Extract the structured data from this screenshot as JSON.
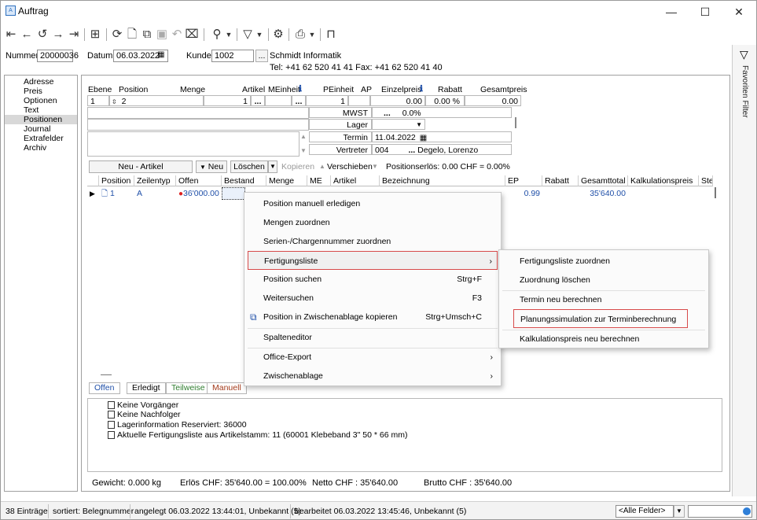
{
  "window": {
    "title": "Auftrag",
    "minimize": "—",
    "maximize": "☐",
    "close": "✕"
  },
  "header": {
    "nummer_label": "Nummer",
    "nummer_value": "20000036",
    "datum_label": "Datum",
    "datum_value": "06.03.2022",
    "kunde_label": "Kunde",
    "kunde_value": "1002",
    "kunde_name": "Schmidt Informatik",
    "kunde_contact": "Tel: +41 62 520 41 41   Fax: +41 62 520 41 40",
    "ellipsis": "..."
  },
  "nav": {
    "items": [
      "Adresse",
      "Preis",
      "Optionen",
      "Text",
      "Positionen",
      "Journal",
      "Extrafelder",
      "Archiv"
    ],
    "selected": "Positionen"
  },
  "right_panel": {
    "label": "Favoriten Filter"
  },
  "position_form": {
    "headers": {
      "ebene": "Ebene",
      "position": "Position",
      "menge": "Menge",
      "artikel": "Artikel",
      "meinheit": "MEinheit",
      "peinheit": "PEinheit",
      "ap": "AP",
      "einzelpreis": "Einzelpreis",
      "rabatt": "Rabatt",
      "gesamtpreis": "Gesamtpreis"
    },
    "values": {
      "ebene": "1",
      "position": "2",
      "menge": "1",
      "peinheit": "1",
      "einzelpreis": "0.00",
      "rabatt": "0.00 %",
      "gesamtpreis": "0.00"
    },
    "mwst_label": "MWST",
    "mwst_value": "0.0%",
    "lager_label": "Lager",
    "termin_label": "Termin",
    "termin_value": "11.04.2022",
    "vertreter_label": "Vertreter",
    "vertreter_value": "004",
    "vertreter_name": "Degelo, Lorenzo"
  },
  "grid_toolbar": {
    "neu_artikel": "Neu - Artikel",
    "neu": "Neu",
    "loeschen": "Löschen",
    "kopieren": "Kopieren",
    "verschieben": "Verschieben",
    "positionserloes": "Positionserlös:  0.00 CHF = 0.00%"
  },
  "grid": {
    "columns": [
      "Position",
      "Zeilentyp",
      "Offen",
      "Bestand",
      "Menge",
      "ME",
      "Artikel",
      "Bezeichnung",
      "EP",
      "Rabatt",
      "Gesamttotal",
      "Kalkulationspreis",
      "Ste"
    ],
    "row": {
      "position": "1",
      "zeilentyp": "A",
      "offen": "36'000.00",
      "ep": "0.99",
      "gesamttotal": "35'640.00"
    }
  },
  "context_menu": {
    "items": [
      {
        "label": "Position manuell erledigen",
        "shortcut": ""
      },
      {
        "label": "Mengen zuordnen",
        "shortcut": ""
      },
      {
        "label": "Serien-/Chargennummer zuordnen",
        "shortcut": ""
      },
      {
        "label": "Fertigungsliste",
        "shortcut": ""
      },
      {
        "label": "Position suchen",
        "shortcut": "Strg+F"
      },
      {
        "label": "Weitersuchen",
        "shortcut": "F3"
      },
      {
        "label": "Position in Zwischenablage kopieren",
        "shortcut": "Strg+Umsch+C"
      },
      {
        "label": "Spalteneditor",
        "shortcut": ""
      },
      {
        "label": "Office-Export",
        "shortcut": ""
      },
      {
        "label": "Zwischenablage",
        "shortcut": ""
      }
    ]
  },
  "submenu": {
    "items": [
      "Fertigungsliste zuordnen",
      "Zuordnung löschen",
      "Termin neu berechnen",
      "Planungssimulation zur Terminberechnung",
      "Kalkulationspreis neu berechnen"
    ]
  },
  "tabs": [
    "Offen",
    "Erledigt",
    "Teilweise",
    "Manuell"
  ],
  "tab_colors": {
    "offen": "#1f4fa8",
    "erledigt": "#000000",
    "teilweise": "#2f7d2f",
    "manuell": "#a33a1a"
  },
  "info_lines": [
    "Keine Vorgänger",
    "Keine Nachfolger",
    "Lagerinformation Reserviert: 36000",
    "Aktuelle Fertigungsliste aus Artikelstamm: 11 (60001 Klebeband 3\" 50 * 66 mm)"
  ],
  "totals": {
    "gewicht": "Gewicht:  0.000 kg",
    "erloes": "Erlös CHF: 35'640.00 = 100.00%",
    "netto": "Netto CHF : 35'640.00",
    "brutto": "Brutto CHF : 35'640.00"
  },
  "status": {
    "eintraege": "38 Einträge",
    "sortiert": "sortiert: Belegnummer",
    "angelegt": "angelegt 06.03.2022 13:44:01, Unbekannt (5)",
    "bearbeitet": "bearbeitet 06.03.2022 13:45:46, Unbekannt (5)",
    "filter": "<Alle Felder>"
  }
}
